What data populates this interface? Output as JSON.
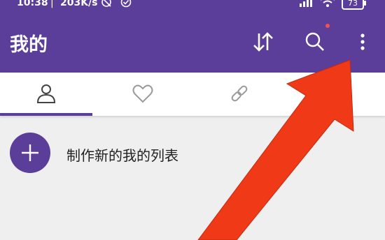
{
  "status_bar": {
    "time": "10:38",
    "separator": "|",
    "net_speed": "203K/s",
    "battery": "73",
    "icons": [
      "alarm-off-icon",
      "check-circle-icon",
      "signal-icon",
      "wifi-icon",
      "battery-icon"
    ]
  },
  "app_bar": {
    "title": "我的",
    "actions": [
      "sort-icon",
      "search-icon",
      "more-vert-icon"
    ],
    "notification_dot_color": "#ef5350"
  },
  "tabs": [
    {
      "icon": "person-icon",
      "selected": true
    },
    {
      "icon": "heart-icon",
      "selected": false
    },
    {
      "icon": "link-icon",
      "selected": false
    }
  ],
  "create_list": {
    "icon": "plus-icon",
    "label": "制作新的我的列表"
  },
  "annotation": {
    "icon": "red-arrow-icon",
    "color": "#f03a17"
  },
  "colors": {
    "accent": "#5b3d9a",
    "background": "#efefef",
    "tab_bar": "#ffffff"
  }
}
